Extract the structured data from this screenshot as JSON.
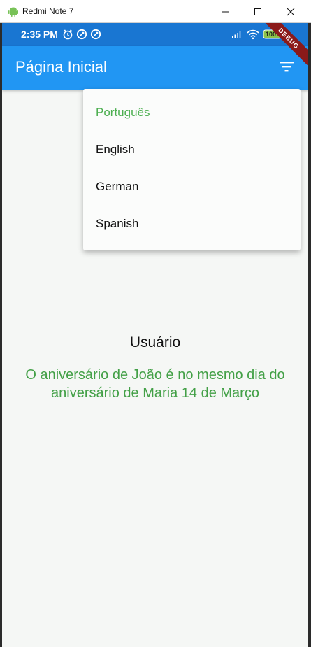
{
  "window": {
    "title": "Redmi Note 7",
    "icon": "android-icon"
  },
  "statusbar": {
    "time": "2:35 PM",
    "icons": [
      "alarm-icon",
      "app-icon",
      "app-icon",
      "signal-icon",
      "wifi-icon",
      "battery-icon"
    ],
    "battery": "100",
    "debug_banner": "DEBUG"
  },
  "appbar": {
    "title": "Página Inicial",
    "action_icon": "filter-icon"
  },
  "menu": {
    "items": [
      {
        "label": "Português",
        "selected": true
      },
      {
        "label": "English",
        "selected": false
      },
      {
        "label": "German",
        "selected": false
      },
      {
        "label": "Spanish",
        "selected": false
      }
    ]
  },
  "main": {
    "user_label": "Usuário",
    "birthday_text": "O aniversário de João é no mesmo dia do aniversário de Maria 14 de Março"
  },
  "colors": {
    "appbar": "#2196f3",
    "statusbar": "#1976d2",
    "accent_green": "#4caf50",
    "background": "#f5f7f5"
  }
}
